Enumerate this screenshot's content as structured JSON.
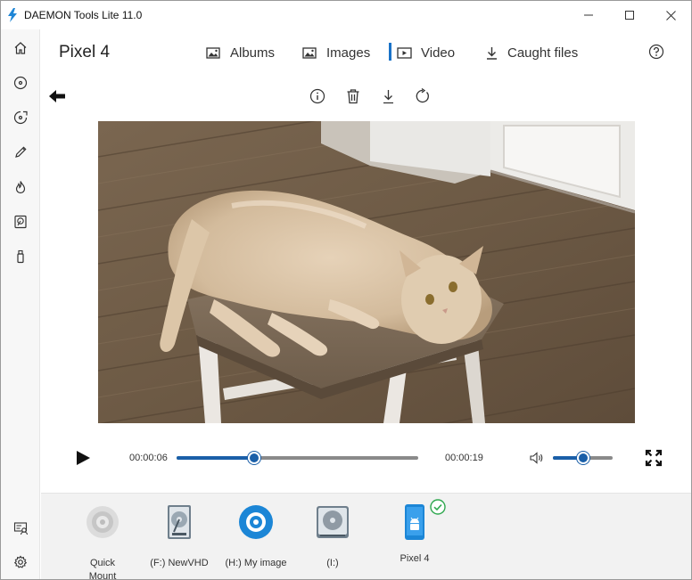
{
  "window": {
    "title": "DAEMON Tools Lite 11.0"
  },
  "sidebar": {
    "items": [
      {
        "icon": "home-icon"
      },
      {
        "icon": "disc-icon"
      },
      {
        "icon": "image-disc-icon"
      },
      {
        "icon": "pencil-icon"
      },
      {
        "icon": "flame-icon"
      },
      {
        "icon": "virtual-hdd-icon"
      },
      {
        "icon": "usb-drive-icon"
      }
    ],
    "bottom": [
      {
        "icon": "license-icon"
      },
      {
        "icon": "gear-icon"
      }
    ]
  },
  "header": {
    "device": "Pixel 4",
    "tabs": [
      {
        "label": "Albums",
        "icon": "album-icon",
        "active": false
      },
      {
        "label": "Images",
        "icon": "image-icon",
        "active": false
      },
      {
        "label": "Video",
        "icon": "video-icon",
        "active": true
      },
      {
        "label": "Caught files",
        "icon": "download-icon",
        "active": false
      }
    ]
  },
  "player": {
    "current_time": "00:00:06",
    "total_time": "00:00:19",
    "progress": 0.32,
    "volume": 0.5
  },
  "colors": {
    "accent": "#1a73c8",
    "slider": "#1a5fa8",
    "success": "#2fa84f"
  },
  "drives": [
    {
      "label": "Quick\nMount",
      "icon": "quick-mount-icon"
    },
    {
      "label": "(F:) NewVHD",
      "icon": "hdd-icon"
    },
    {
      "label": "(H:) My image",
      "icon": "blue-disc-icon"
    },
    {
      "label": "(I:)",
      "icon": "optical-drive-icon"
    },
    {
      "label": "Pixel 4",
      "icon": "android-phone-icon",
      "connected": true
    }
  ]
}
